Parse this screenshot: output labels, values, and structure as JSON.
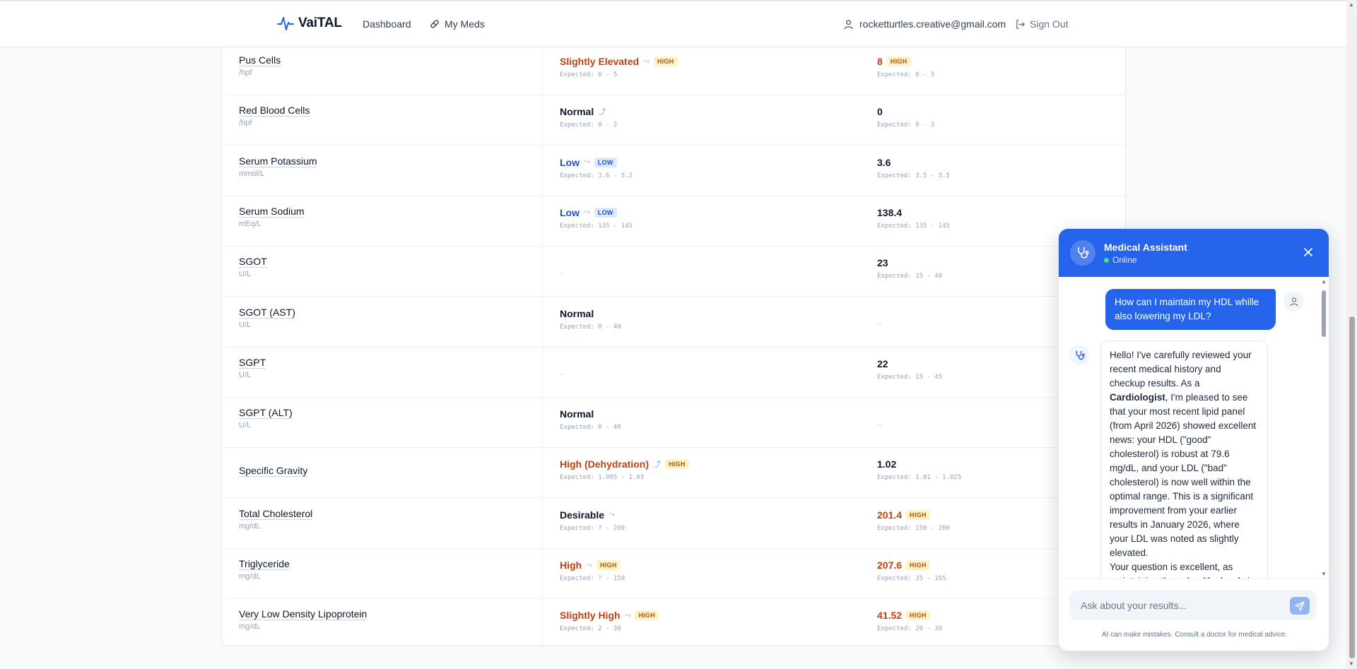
{
  "header": {
    "brand": "VaiTAL",
    "nav": [
      {
        "label": "Dashboard",
        "icon": "none"
      },
      {
        "label": "My Meds",
        "icon": "pill-icon"
      }
    ],
    "user_email": "rocketturtles.creative@gmail.com",
    "sign_out": "Sign Out"
  },
  "colors": {
    "accent": "#2563eb",
    "high": "#c2410c",
    "low": "#1d4ed8",
    "high_badge_bg": "#fef3c7",
    "low_badge_bg": "#dbeafe"
  },
  "rows": [
    {
      "name": "Pus Cells",
      "unit": "/hpf",
      "a": {
        "status": "Slightly Elevated",
        "tone": "high",
        "trend": "down-icon",
        "badge": "HIGH",
        "expected": "Expected: 0 - 5"
      },
      "b": {
        "value": "8",
        "tone": "high",
        "badge": "HIGH",
        "expected": "Expected: 0 - 5"
      }
    },
    {
      "name": "Red Blood Cells",
      "unit": "/hpf",
      "a": {
        "status": "Normal",
        "tone": "normal",
        "trend": "up-icon",
        "badge": "",
        "expected": "Expected: 0 - 2"
      },
      "b": {
        "value": "0",
        "tone": "normal",
        "badge": "",
        "expected": "Expected: 0 - 3"
      }
    },
    {
      "name": "Serum Potassium",
      "unit": "mmol/L",
      "a": {
        "status": "Low",
        "tone": "low",
        "trend": "down-icon",
        "badge": "LOW",
        "expected": "Expected: 3.6 - 5.2"
      },
      "b": {
        "value": "3.6",
        "tone": "normal",
        "badge": "",
        "expected": "Expected: 3.5 - 5.5"
      }
    },
    {
      "name": "Serum Sodium",
      "unit": "mEq/L",
      "a": {
        "status": "Low",
        "tone": "low",
        "trend": "down-icon",
        "badge": "LOW",
        "expected": "Expected: 135 - 145"
      },
      "b": {
        "value": "138.4",
        "tone": "normal",
        "badge": "",
        "expected": "Expected: 135 - 145"
      }
    },
    {
      "name": "SGOT",
      "unit": "U/L",
      "a": {
        "status": "–",
        "tone": "empty",
        "trend": "",
        "badge": "",
        "expected": ""
      },
      "b": {
        "value": "23",
        "tone": "normal",
        "badge": "",
        "expected": "Expected: 15 - 40"
      }
    },
    {
      "name": "SGOT (AST)",
      "unit": "U/L",
      "a": {
        "status": "Normal",
        "tone": "normal",
        "trend": "",
        "badge": "",
        "expected": "Expected: 0 - 40"
      },
      "b": {
        "value": "–",
        "tone": "empty",
        "badge": "",
        "expected": ""
      }
    },
    {
      "name": "SGPT",
      "unit": "U/L",
      "a": {
        "status": "–",
        "tone": "empty",
        "trend": "",
        "badge": "",
        "expected": ""
      },
      "b": {
        "value": "22",
        "tone": "normal",
        "badge": "",
        "expected": "Expected: 15 - 45"
      }
    },
    {
      "name": "SGPT (ALT)",
      "unit": "U/L",
      "a": {
        "status": "Normal",
        "tone": "normal",
        "trend": "",
        "badge": "",
        "expected": "Expected: 0 - 40"
      },
      "b": {
        "value": "–",
        "tone": "empty",
        "badge": "",
        "expected": ""
      }
    },
    {
      "name": "Specific Gravity",
      "unit": "",
      "a": {
        "status": "High (Dehydration)",
        "tone": "high",
        "trend": "up-icon",
        "badge": "HIGH",
        "expected": "Expected: 1.005 - 1.03"
      },
      "b": {
        "value": "1.02",
        "tone": "normal",
        "badge": "",
        "expected": "Expected: 1.01 - 1.025"
      }
    },
    {
      "name": "Total Cholesterol",
      "unit": "mg/dL",
      "a": {
        "status": "Desirable",
        "tone": "normal",
        "trend": "down-icon",
        "badge": "",
        "expected": "Expected: ? - 200"
      },
      "b": {
        "value": "201.4",
        "tone": "high",
        "badge": "HIGH",
        "expected": "Expected: 150 - 200"
      }
    },
    {
      "name": "Triglyceride",
      "unit": "mg/dL",
      "a": {
        "status": "High",
        "tone": "high",
        "trend": "down-icon",
        "badge": "HIGH",
        "expected": "Expected: ? - 150"
      },
      "b": {
        "value": "207.6",
        "tone": "high",
        "badge": "HIGH",
        "expected": "Expected: 35 - 165"
      }
    },
    {
      "name": "Very Low Density Lipoprotein",
      "unit": "mg/dL",
      "a": {
        "status": "Slightly High",
        "tone": "high",
        "trend": "down-icon",
        "badge": "HIGH",
        "expected": "Expected: 2 - 30"
      },
      "b": {
        "value": "41.52",
        "tone": "high",
        "badge": "HIGH",
        "expected": "Expected: 20 - 38"
      }
    }
  ],
  "chat": {
    "title": "Medical Assistant",
    "status": "Online",
    "user_message": "How can I maintain my HDL whille also lowering my LDL?",
    "bot_message": {
      "p1_before": "Hello! I've carefully reviewed your recent medical history and checkup results. As a ",
      "p1_bold": "Cardiologist",
      "p1_after": ", I'm pleased to see that your most recent lipid panel (from April 2026) showed excellent news: your HDL (\"good\" cholesterol) is robust at 79.6 mg/dL, and your LDL (\"bad\" cholesterol) is now well within the optimal range. This is a significant improvement from your earlier results in January 2026, where your LDL was noted as slightly elevated.",
      "p2": "Your question is excellent, as maintaining these healthy levels is"
    },
    "input_placeholder": "Ask about your results...",
    "disclaimer": "AI can make mistakes. Consult a doctor for medical advice."
  }
}
